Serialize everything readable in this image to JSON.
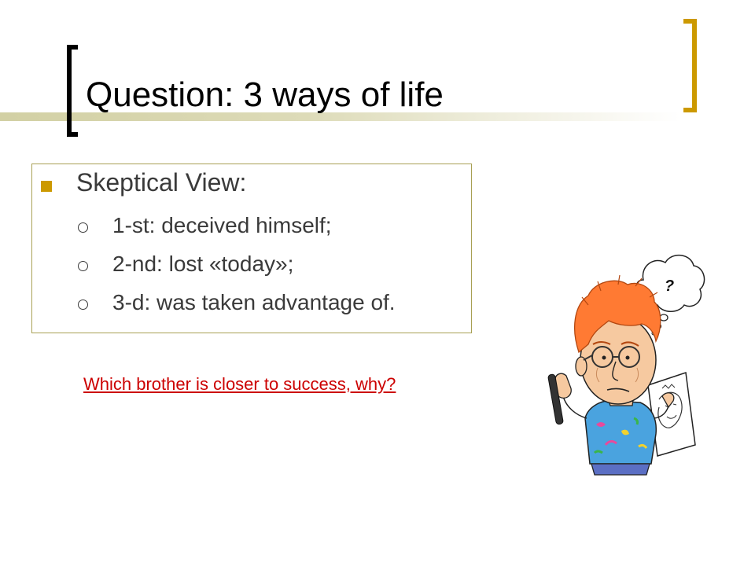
{
  "slide": {
    "title": "Question: 3 ways of life",
    "heading": "Skeptical View:",
    "items": [
      "1-st: deceived himself;",
      "2-nd: lost «today»;",
      "3-d: was taken advantage of."
    ],
    "question_link": "Which brother is closer to success, why?",
    "thought_bubble": "?"
  },
  "colors": {
    "accent_gold": "#cc9900",
    "title_band": "#d2d0a4",
    "box_border": "#a8a054",
    "text": "#3a3a3a",
    "link": "#cc0000"
  },
  "icons": {
    "main_bullet": "square-bullet-icon",
    "sub_bullet": "hollow-circle-bullet-icon",
    "illustration": "thinking-artist-cartoon"
  }
}
